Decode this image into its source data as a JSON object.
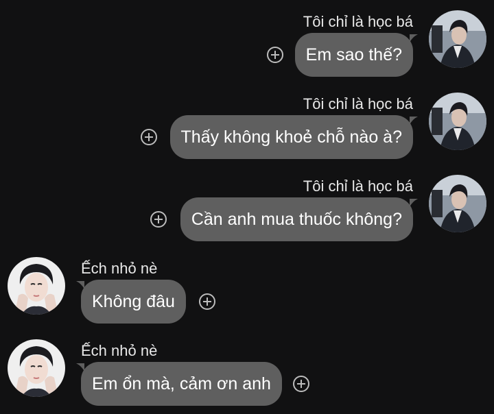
{
  "messages": [
    {
      "sender": "Tôi chỉ là học bá",
      "text": "Em sao thế?",
      "side": "right",
      "avatar": "boy-avatar"
    },
    {
      "sender": "Tôi chỉ là học bá",
      "text": "Thấy không khoẻ chỗ nào à?",
      "side": "right",
      "avatar": "boy-avatar"
    },
    {
      "sender": "Tôi chỉ là học bá",
      "text": "Cần anh mua thuốc không?",
      "side": "right",
      "avatar": "boy-avatar"
    },
    {
      "sender": "Ếch nhỏ nè",
      "text": "Không đâu",
      "side": "left",
      "avatar": "girl-avatar"
    },
    {
      "sender": "Ếch nhỏ nè",
      "text": "Em ổn mà, cảm ơn anh",
      "side": "left",
      "avatar": "girl-avatar"
    }
  ],
  "icons": {
    "add_reaction": "plus-circle-icon"
  },
  "colors": {
    "background": "#111112",
    "bubble": "#5f5f5f",
    "text": "#ffffff",
    "name": "#e8e8e8",
    "icon": "#bdbdbd"
  }
}
